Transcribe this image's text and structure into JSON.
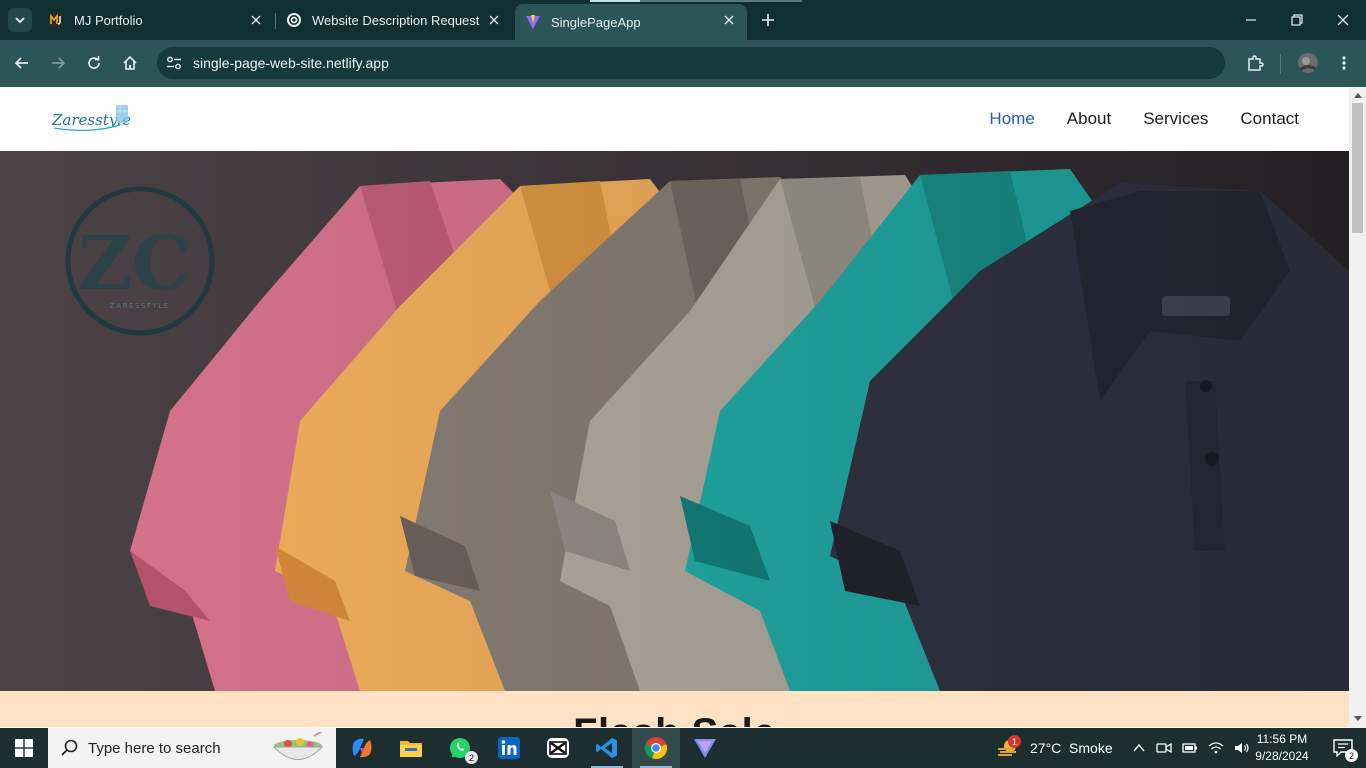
{
  "browser": {
    "tabs": [
      {
        "title": "MJ Portfolio"
      },
      {
        "title": "Website Description Request"
      },
      {
        "title": "SinglePageApp"
      }
    ],
    "url": "single-page-web-site.netlify.app"
  },
  "site": {
    "logo_text": "Zaresstyle",
    "nav": [
      "Home",
      "About",
      "Services",
      "Contact"
    ],
    "hero_logo_text": "ZC",
    "hero_logo_sub": "ZARESSTYLE",
    "flash_title": "Flash Sale"
  },
  "taskbar": {
    "search_placeholder": "Type here to search",
    "whatsapp_badge": "2",
    "weather_badge": "1",
    "weather": "27°C  Smoke",
    "time": "11:56 PM",
    "date": "9/28/2024",
    "notifications": "2"
  },
  "colors": {
    "tabbar": "#0f2f30",
    "toolbar": "#2c5557",
    "nav_active": "#2a5bb5",
    "flash_bg": "#ffe2c3",
    "shirts": [
      "#d9748f",
      "#f6b25e",
      "#8b8178",
      "#b7b0a4",
      "#23b2ad",
      "#353646"
    ]
  }
}
